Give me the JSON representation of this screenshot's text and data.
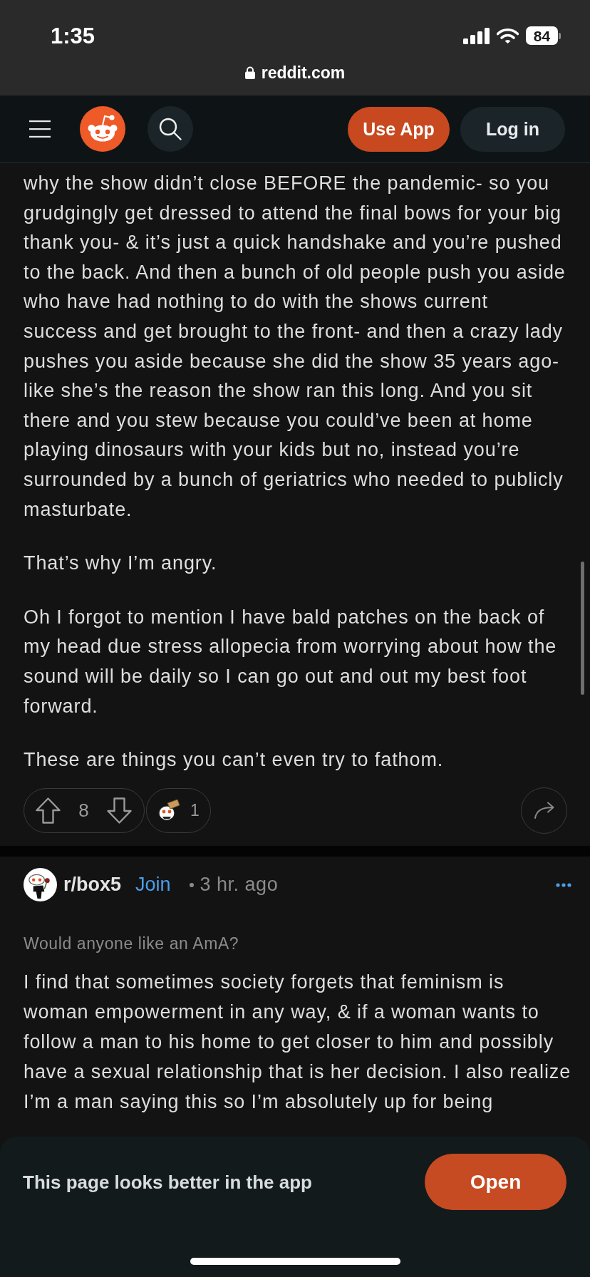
{
  "status_bar": {
    "time": "1:35",
    "battery": "84"
  },
  "browser": {
    "url": "reddit.com"
  },
  "header": {
    "buttons": [
      {
        "label": "Use App",
        "kind": "primary"
      },
      {
        "label": "Log in",
        "kind": "secondary"
      }
    ]
  },
  "comment": {
    "paragraphs": [
      "why the show didn’t close BEFORE the pandemic- so you grudgingly get dressed to attend the final bows for your big thank you- & it’s just a quick handshake and you’re pushed to the back. And then a bunch of old people push you aside who have had nothing to do with the shows current success and get brought to the front- and then a crazy lady pushes you aside because she did the show 35 years ago- like she’s the reason the show ran this long. And you sit there and you stew because you could’ve been at home playing dinosaurs with your kids but no, instead you’re surrounded by a bunch of geriatrics who needed to publicly masturbate.",
      "That’s why I’m angry.",
      "Oh I forgot to mention I have bald patches on the back of my head due stress allopecia from worrying about how the sound will be daily so I can go out and out my best foot forward.",
      "These are things you can’t even try to fathom."
    ],
    "votes": "8",
    "awards": "1"
  },
  "post": {
    "subreddit": "r/box5",
    "join": "Join",
    "time": "3 hr. ago",
    "title": "Would anyone like an AmA?",
    "body": "I find that sometimes society forgets that feminism is woman empowerment in any way, & if a woman wants to follow a man to his home to get closer to him and possibly have a sexual relationship that is her decision. I also realize I’m a man saying this so I’m absolutely up for being"
  },
  "banner": {
    "message": "This page looks better in the app",
    "button": "Open"
  }
}
